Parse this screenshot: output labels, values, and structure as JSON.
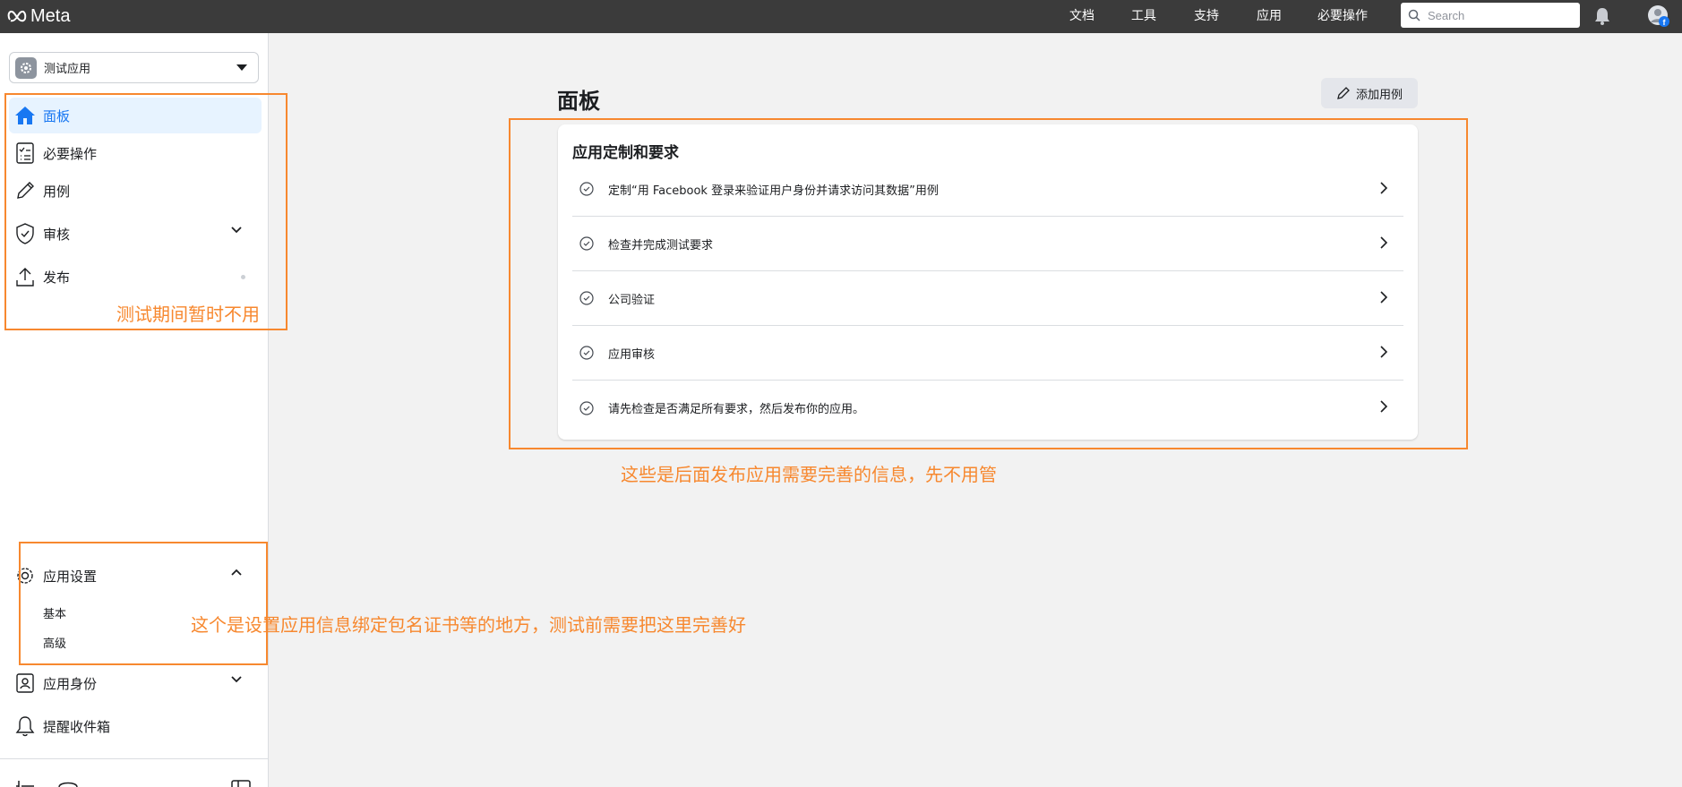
{
  "topbar": {
    "brand": "Meta",
    "nav": [
      "文档",
      "工具",
      "支持",
      "应用",
      "必要操作"
    ],
    "search_placeholder": "Search"
  },
  "sidebar": {
    "app_name": "测试应用",
    "items": [
      {
        "label": "面板",
        "icon": "home-icon",
        "active": true
      },
      {
        "label": "必要操作",
        "icon": "checklist-icon"
      },
      {
        "label": "用例",
        "icon": "pencil-icon"
      },
      {
        "label": "审核",
        "icon": "shield-check-icon"
      },
      {
        "label": "发布",
        "icon": "upload-icon"
      }
    ],
    "settings": {
      "label": "应用设置",
      "sub_items": [
        "基本",
        "高级"
      ]
    },
    "identity_label": "应用身份",
    "inbox_label": "提醒收件箱"
  },
  "main": {
    "title": "面板",
    "add_button_label": "添加用例",
    "card_title": "应用定制和要求",
    "requirements": [
      "定制“用 Facebook 登录来验证用户身份并请求访问其数据”用例",
      "检查并完成测试要求",
      "公司验证",
      "应用审核",
      "请先检查是否满足所有要求，然后发布你的应用。"
    ]
  },
  "annotations": {
    "sidebar_note": "测试期间暂时不用",
    "card_note": "这些是后面发布应用需要完善的信息，先不用管",
    "settings_note": "这个是设置应用信息绑定包名证书等的地方，测试前需要把这里完善好"
  },
  "colors": {
    "topbar": "#3b3b3b",
    "accent": "#1877f2",
    "annotation": "#f7882f"
  }
}
